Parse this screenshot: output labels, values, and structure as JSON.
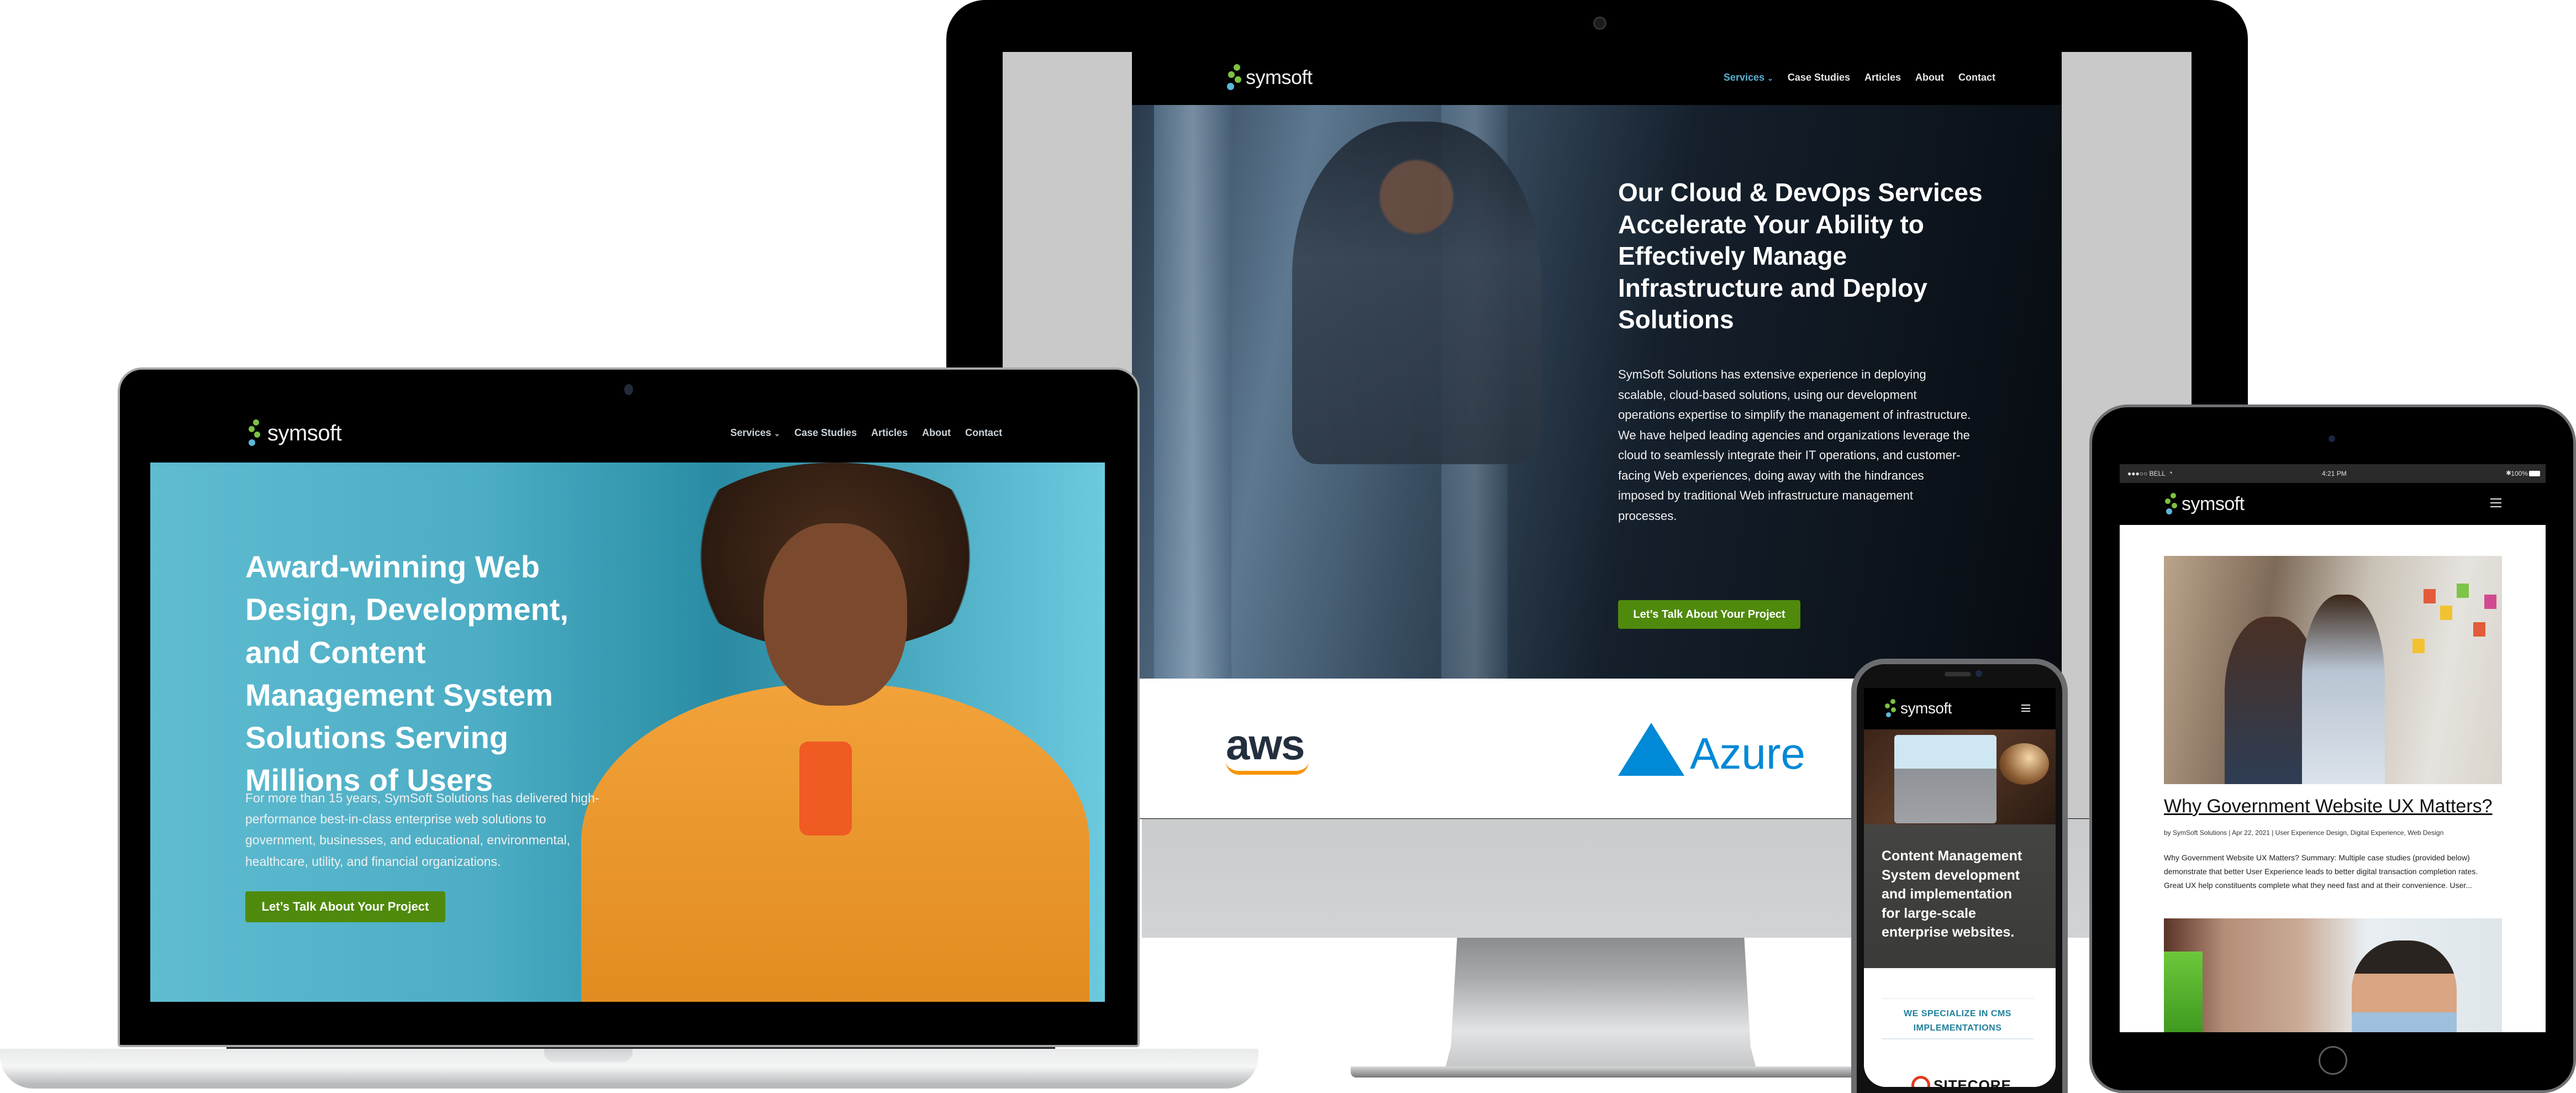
{
  "brand": {
    "name": "symsoft",
    "colors": {
      "green": "#7dc142",
      "blue": "#5ab8d8",
      "cta": "#4f8a0c",
      "nav_active": "#5ab0d4",
      "cms_heading": "#1f7f9a"
    }
  },
  "nav": {
    "items": [
      {
        "label": "Services",
        "icon": "chevron-down-icon",
        "active": true
      },
      {
        "label": "Case Studies"
      },
      {
        "label": "Articles"
      },
      {
        "label": "About"
      },
      {
        "label": "Contact"
      }
    ],
    "chevron": "⌄"
  },
  "desktop": {
    "hero_title": "Our Cloud & DevOps Services Accelerate Your Ability to Effectively Manage Infrastructure and Deploy Solutions",
    "hero_body": "SymSoft Solutions has extensive experience in deploying scalable, cloud-based solutions, using our development operations expertise to simplify the management of infrastructure. We have helped leading agencies and organizations leverage the cloud to seamlessly integrate their IT operations, and customer-facing Web experiences, doing away with the hindrances imposed by traditional Web infrastructure management processes.",
    "cta_label": "Let’s Talk About Your Project",
    "partners": [
      {
        "name": "aws",
        "color": "#232f3e",
        "accent": "#f79400"
      },
      {
        "name": "Azure",
        "color": "#0089d6"
      }
    ]
  },
  "laptop": {
    "hero_title": "Award-winning Web Design, Development, and Content Management System Solutions Serving Millions of Users",
    "hero_body": "For more than 15 years, SymSoft Solutions has delivered high-performance best-in-class enterprise web solutions to government, businesses, and educational, environmental, healthcare, utility, and financial organizations.",
    "cta_label": "Let’s Talk About Your Project"
  },
  "phone": {
    "hero_title": "Content Management System development and implementation for large-scale enterprise websites.",
    "section_heading": "WE SPECIALIZE IN CMS IMPLEMENTATIONS",
    "partner_logo": "SITECORE"
  },
  "tablet": {
    "status_bar": {
      "carrier": "●●●○○ BELL",
      "wifi": "wifi-icon",
      "time": "4:21 PM",
      "bluetooth": "✱",
      "battery": "100%"
    },
    "article": {
      "title": "Why Government Website UX Matters?",
      "meta": "by SymSoft Solutions | Apr 22, 2021 | User Experience Design, Digital Experience, Web Design",
      "excerpt": "Why Government Website UX Matters? Summary: Multiple case studies (provided below) demonstrate that better User Experience leads to better digital transaction completion rates. Great UX help constituents complete what they need fast and at their convenience. User..."
    }
  }
}
